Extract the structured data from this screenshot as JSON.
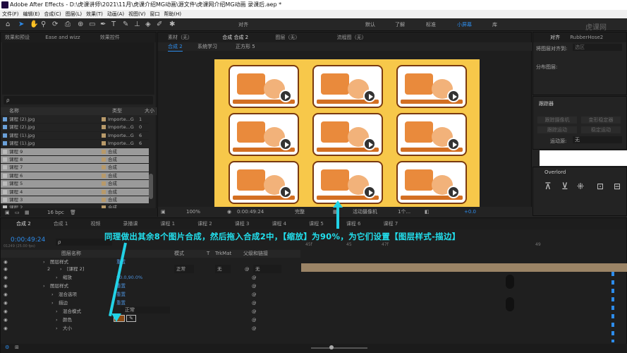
{
  "window": {
    "title": "Adobe After Effects - D:\\虎课讲师\\2021\\11月\\虎课介绍MG动画\\源文件\\虎课网介绍MG动画 录课后.aep *"
  },
  "menu": [
    "文件(F)",
    "编辑(E)",
    "合成(C)",
    "图层(L)",
    "效果(T)",
    "动画(A)",
    "视图(V)",
    "窗口",
    "帮助(H)"
  ],
  "toolbar": {
    "snap_label": "对齐",
    "workspaces": [
      "默认",
      "了解",
      "标准",
      "小屏幕",
      "库"
    ],
    "watermark": "虎课网"
  },
  "project": {
    "tabs": [
      "效果和预设",
      "Ease and wizz",
      "效果控件"
    ],
    "search_placeholder": "ρ",
    "columns": [
      "名称",
      "类型",
      "大小"
    ],
    "items": [
      {
        "name": "课程 (2).jpg",
        "type": "Importe...G",
        "size": "1",
        "sel": false
      },
      {
        "name": "课程 (2).jpg",
        "type": "Importe...G",
        "size": "0",
        "sel": false
      },
      {
        "name": "课程 (1).jpg",
        "type": "Importe...G",
        "size": "6",
        "sel": false
      },
      {
        "name": "课程 (1).jpg",
        "type": "Importe...G",
        "size": "6",
        "sel": false
      },
      {
        "name": "课程 9",
        "type": "合成",
        "size": "",
        "sel": true
      },
      {
        "name": "课程 8",
        "type": "合成",
        "size": "",
        "sel": true
      },
      {
        "name": "课程 7",
        "type": "合成",
        "size": "",
        "sel": true
      },
      {
        "name": "课程 6",
        "type": "合成",
        "size": "",
        "sel": true
      },
      {
        "name": "课程 5",
        "type": "合成",
        "size": "",
        "sel": true
      },
      {
        "name": "课程 4",
        "type": "合成",
        "size": "",
        "sel": true
      },
      {
        "name": "课程 3",
        "type": "合成",
        "size": "",
        "sel": true
      },
      {
        "name": "课程 2",
        "type": "合成",
        "size": "",
        "sel": false
      }
    ],
    "bpc": "16 bpc"
  },
  "viewer": {
    "tabs": [
      "素材（无）",
      "合成 合成 2",
      "图层（无）",
      "流程图（无）"
    ],
    "breadcrumbs": [
      "合成 2",
      "系统学习",
      "正方形 5"
    ],
    "zoom": "100%",
    "timecode": "0:00:49:24",
    "quality": "完整",
    "camera": "活动摄像机",
    "views": "1个...",
    "exposure": "+0.0"
  },
  "right": {
    "align_title": "对齐",
    "rubberhose": "RubberHose2",
    "align_to_label": "将图层对齐到:",
    "align_to_value": "选区",
    "distribute_label": "分布图层:",
    "tracker_title": "跟踪器",
    "tracker_buttons": [
      "跟踪摄像机",
      "变形稳定器",
      "跟踪运动",
      "稳定运动"
    ],
    "motion_source_label": "运动源:",
    "motion_source_value": "无",
    "overlord": "Overlord"
  },
  "timeline": {
    "tabs": [
      "合成 2",
      "合成 1",
      "视频",
      "录播课",
      "课程 1",
      "课程 2",
      "课程 3",
      "课程 4",
      "课程 5",
      "课程 6",
      "课程 7"
    ],
    "timecode": "0:00:49:24",
    "fps": "01249 (25.00 fps)",
    "headers": [
      "图层名称",
      "模式",
      "T",
      "TrkMat",
      "父级和链接"
    ],
    "ruler": [
      "45f",
      "45",
      "47f",
      "49"
    ],
    "rows": [
      {
        "label": "图层样式",
        "extra": "重置"
      },
      {
        "label": "[课程 2]",
        "extra": "正常"
      },
      {
        "label": "缩放",
        "extra": "90.0,90.0%"
      },
      {
        "label": "图层样式",
        "extra": "重置"
      },
      {
        "label": "混合选项",
        "extra": "重置"
      },
      {
        "label": "描边",
        "extra": "重置"
      },
      {
        "label": "混合模式",
        "extra": "正常"
      },
      {
        "label": "颜色",
        "extra": ""
      },
      {
        "label": "大小",
        "extra": ""
      }
    ],
    "mode_value": "正常",
    "trkmat_value": "无",
    "parent_value": "无",
    "layer_num": "2"
  },
  "caption": "同理做出其余8个图片合成，然后拖入合成2中，【缩放】为90%，为它们设置【图层样式-描边】",
  "colors": {
    "accent_blue": "#2d8ceb",
    "cyan_caption": "#22e0ee",
    "comp_bg": "#f7c84a",
    "stroke_color": "#8a4a14"
  }
}
